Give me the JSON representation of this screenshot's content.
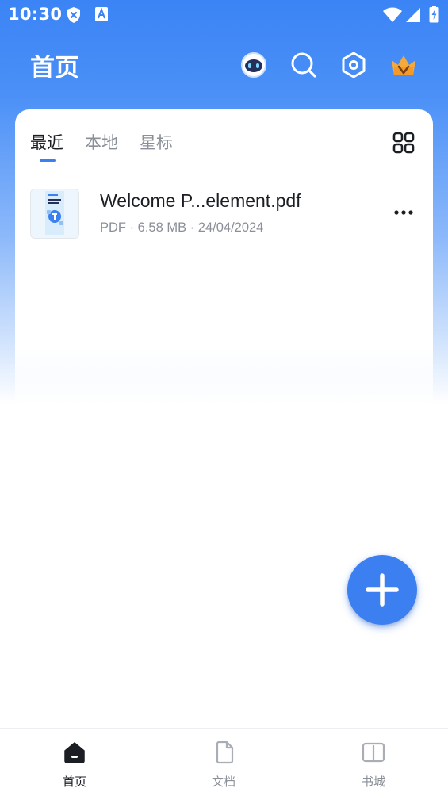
{
  "status_bar": {
    "time": "10:30",
    "icons": [
      "shield-x-icon",
      "translate-a-icon",
      "wifi-icon",
      "cellular-signal-icon",
      "battery-charging-icon"
    ]
  },
  "header": {
    "title": "首页",
    "actions": [
      "assistant-robot-icon",
      "search-icon",
      "settings-hexagon-icon",
      "premium-crown-icon"
    ]
  },
  "tabs": [
    {
      "label": "最近",
      "active": true
    },
    {
      "label": "本地",
      "active": false
    },
    {
      "label": "星标",
      "active": false
    }
  ],
  "files": [
    {
      "name": "Welcome P...element.pdf",
      "meta": "PDF · 6.58 MB · 24/04/2024"
    }
  ],
  "bottom_nav": [
    {
      "label": "首页",
      "icon": "home-icon",
      "active": true
    },
    {
      "label": "文档",
      "icon": "document-icon",
      "active": false
    },
    {
      "label": "书城",
      "icon": "book-icon",
      "active": false
    }
  ],
  "colors": {
    "accent": "#3b7ff0",
    "header_gradient_top": "#3b84f5",
    "text_primary": "#1b1f24",
    "text_secondary": "#8a8f98"
  }
}
